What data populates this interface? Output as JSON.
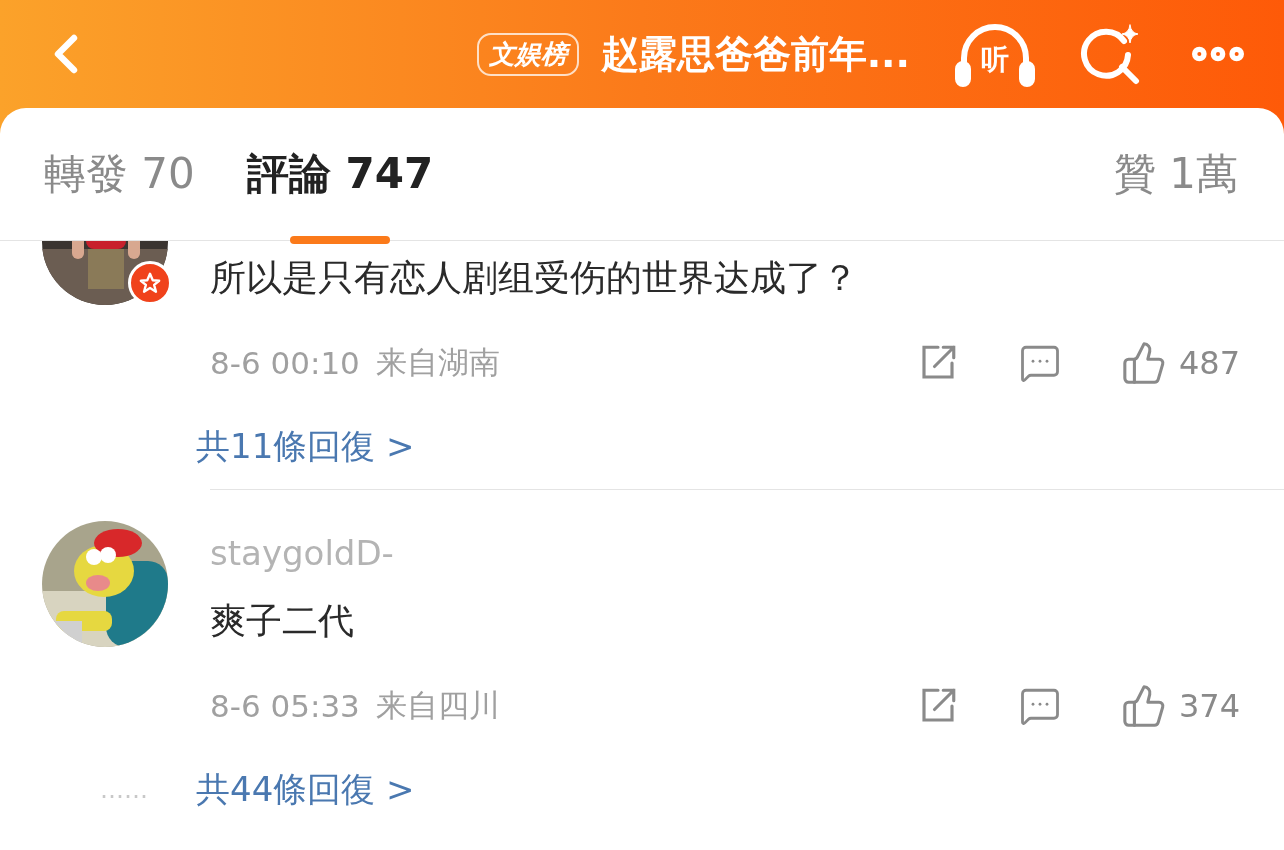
{
  "header": {
    "rank_badge": "文娱榜",
    "title": "赵露思爸爸前年...",
    "listen_label": "听"
  },
  "tabs": [
    {
      "kind": "tab",
      "label": "轉發",
      "count": "70",
      "selected": false
    },
    {
      "kind": "tab",
      "label": "評論",
      "count": "747",
      "selected": true
    },
    {
      "kind": "likes",
      "label": "贊",
      "count": "1萬",
      "selected": false
    }
  ],
  "comments": [
    {
      "text": "所以是只有恋人剧组受伤的世界达成了？",
      "time": "8-6 00:10",
      "location": "来自湖南",
      "likes": "487",
      "replies": "共11條回復 >",
      "verified": true
    },
    {
      "username": "staygoldD-",
      "text": "爽子二代",
      "time": "8-6 05:33",
      "location": "来自四川",
      "likes": "374",
      "reply_lead": "……",
      "replies": "共44條回復 >",
      "verified": false
    }
  ]
}
